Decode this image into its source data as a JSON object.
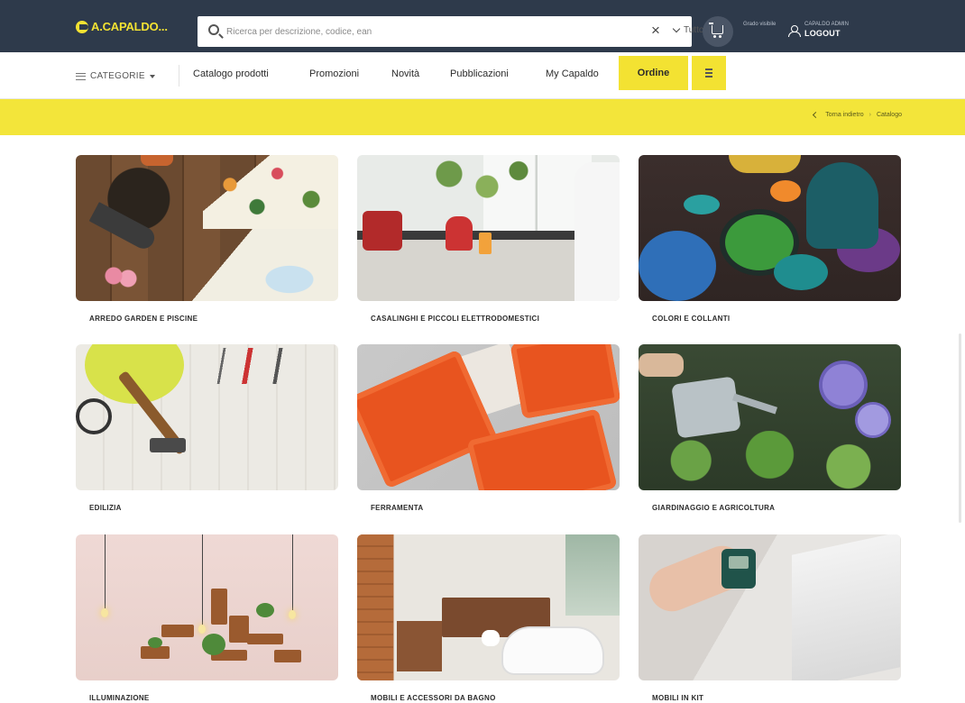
{
  "header": {
    "logo_text": "A.CAPALDO...",
    "search_placeholder": "Ricerca per descrizione, codice, ean",
    "search_scope": "Tutto",
    "user_small_left": "Grado visibile",
    "user_small_right": "CAPALDO ADMIN",
    "logout_label": "LOGOUT"
  },
  "nav": {
    "categories_label": "CATEGORIE",
    "items": [
      "Catalogo prodotti",
      "Promozioni",
      "Novità",
      "Pubblicazioni",
      "My Capaldo"
    ],
    "ordine_label": "Ordine"
  },
  "breadcrumb": {
    "back_label": "Torna indietro",
    "current": "Catalogo"
  },
  "categories": [
    {
      "label": "ARREDO GARDEN E PISCINE",
      "image": "garden-tools-photo"
    },
    {
      "label": "CASALINGHI E PICCOLI ELETTRODOMESTICI",
      "image": "kitchen-appliances-photo"
    },
    {
      "label": "COLORI E COLLANTI",
      "image": "color-pigments-photo"
    },
    {
      "label": "EDILIZIA",
      "image": "construction-tools-photo"
    },
    {
      "label": "FERRAMENTA",
      "image": "hardware-trays-photo"
    },
    {
      "label": "GIARDINAGGIO E AGRICOLTURA",
      "image": "watering-garden-photo"
    },
    {
      "label": "ILLUMINAZIONE",
      "image": "hanging-lights-photo"
    },
    {
      "label": "MOBILI E ACCESSORI DA BAGNO",
      "image": "bathroom-furniture-photo"
    },
    {
      "label": "MOBILI IN KIT",
      "image": "furniture-assembly-photo"
    }
  ],
  "colors": {
    "header_bg": "#2e3a4b",
    "accent_yellow": "#f3e232",
    "strip_yellow": "#f3e53a"
  }
}
